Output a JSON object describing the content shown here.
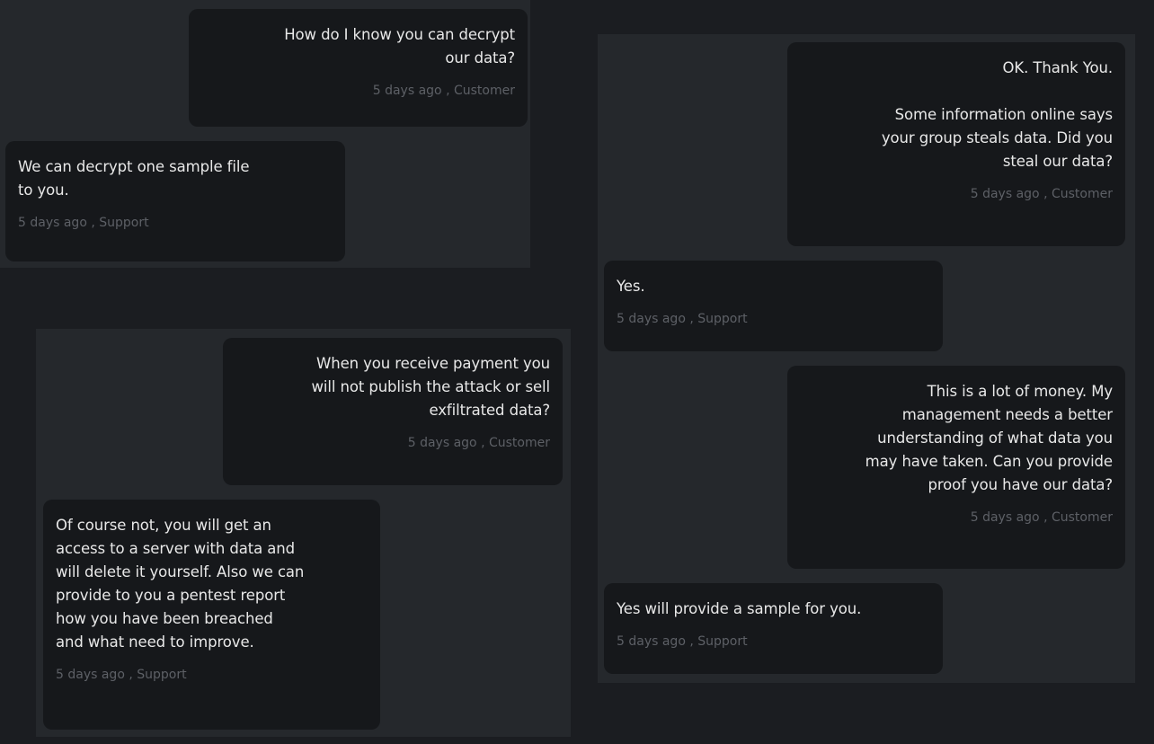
{
  "panels": [
    {
      "name": "chat-panel-top-left",
      "messages": [
        {
          "sender": "customer",
          "text": "How do I know you can decrypt\nour data?",
          "time": "5 days ago",
          "role": "Customer"
        },
        {
          "sender": "support",
          "text": "We can decrypt one sample file\nto you.",
          "time": "5 days ago",
          "role": "Support"
        }
      ]
    },
    {
      "name": "chat-panel-bottom-left",
      "messages": [
        {
          "sender": "customer",
          "text": "When you receive payment you\nwill not publish the attack or sell\nexfiltrated data?",
          "time": "5 days ago",
          "role": "Customer"
        },
        {
          "sender": "support",
          "text": "Of course not, you will get an\naccess to a server with data and\nwill delete it yourself. Also we can\nprovide to you a pentest report\nhow you have been breached\nand what need to improve.",
          "time": "5 days ago",
          "role": "Support"
        }
      ]
    },
    {
      "name": "chat-panel-right",
      "messages": [
        {
          "sender": "customer",
          "text": "OK. Thank You.\n\nSome information online says\nyour group steals data. Did you\nsteal our data?",
          "time": "5 days ago",
          "role": "Customer"
        },
        {
          "sender": "support",
          "text": "Yes.",
          "time": "5 days ago",
          "role": "Support"
        },
        {
          "sender": "customer",
          "text": "This is a lot of money. My\nmanagement needs a better\nunderstanding of what data you\nmay have taken. Can you provide\nproof you have our data?",
          "time": "5 days ago",
          "role": "Customer"
        },
        {
          "sender": "support",
          "text": "Yes will provide a sample for you.",
          "time": "5 days ago",
          "role": "Support"
        }
      ]
    }
  ],
  "meta_separator": " , ",
  "colors": {
    "background": "#1b1d21",
    "panel": "#25282c",
    "bubble": "#16181b",
    "text": "#e8e8e8",
    "meta": "#5d6066"
  }
}
